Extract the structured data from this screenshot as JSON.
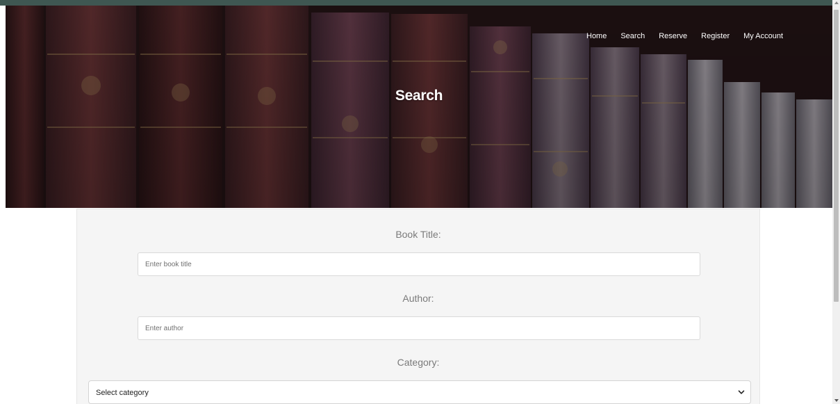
{
  "nav": {
    "items": [
      {
        "label": "Home"
      },
      {
        "label": "Search"
      },
      {
        "label": "Reserve"
      },
      {
        "label": "Register"
      },
      {
        "label": "My Account"
      }
    ]
  },
  "hero": {
    "title": "Search",
    "background": "books-on-shelf-image"
  },
  "form": {
    "title_label": "Book Title:",
    "title_placeholder": "Enter book title",
    "author_label": "Author:",
    "author_placeholder": "Enter author",
    "category_label": "Category:",
    "category_selected": "Select category"
  },
  "colors": {
    "top_strip": "#3f5752",
    "card_bg": "#f5f5f5",
    "label_text": "#7a7a7a"
  }
}
